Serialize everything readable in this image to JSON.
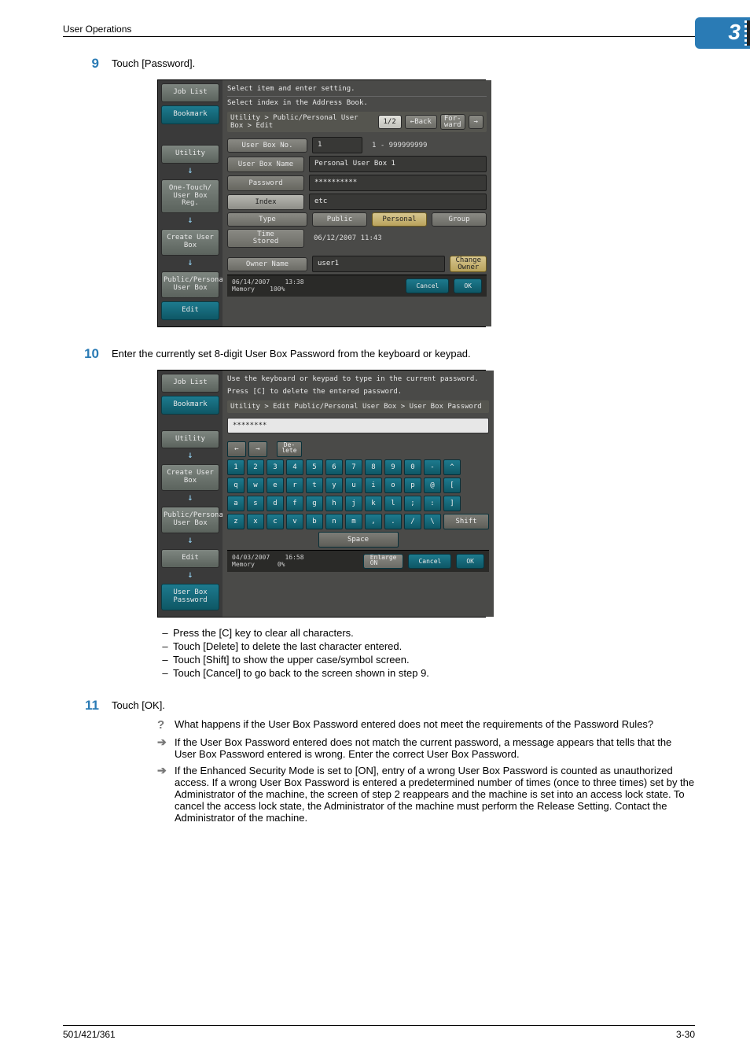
{
  "header": {
    "section": "User Operations",
    "chapter": "3"
  },
  "steps": {
    "s9": {
      "num": "9",
      "text": "Touch [Password]."
    },
    "s10": {
      "num": "10",
      "text": "Enter the currently set 8-digit User Box Password from the keyboard or keypad."
    },
    "s11": {
      "num": "11",
      "text": "Touch [OK]."
    }
  },
  "shot1": {
    "side": {
      "job_list": "Job List",
      "bookmark": "Bookmark",
      "utility": "Utility",
      "one_touch": "One-Touch/\nUser Box Reg.",
      "create_box": "Create User Box",
      "pub_personal": "Public/Personal\nUser Box",
      "edit": "Edit"
    },
    "top1": "Select item and enter setting.",
    "top2": "Select index in the Address Book.",
    "crumb": "Utility > Public/Personal User  Box > Edit",
    "page_ind": "1/2",
    "back": "Back",
    "forward": "For-\nward",
    "nav_prev": "←",
    "nav_next": "→",
    "labels": {
      "boxno": "User Box No.",
      "boxname": "User Box Name",
      "password": "Password",
      "index": "Index",
      "type": "Type",
      "timestored": "Time\nStored",
      "owner": "Owner Name"
    },
    "values": {
      "boxno": "1",
      "boxno_range": "1  -  999999999",
      "boxname": "Personal User Box 1",
      "password": "**********",
      "index": "etc",
      "type_public": "Public",
      "type_personal": "Personal",
      "type_group": "Group",
      "timestored": "06/12/2007   11:43",
      "owner": "user1",
      "change_owner": "Change\nOwner"
    },
    "status": {
      "date": "06/14/2007",
      "time": "13:38",
      "mem_lbl": "Memory",
      "mem": "100%",
      "cancel": "Cancel",
      "ok": "OK"
    }
  },
  "shot2": {
    "side": {
      "job_list": "Job List",
      "bookmark": "Bookmark",
      "utility": "Utility",
      "create_box": "Create User Box",
      "pub_personal": "Public/Personal\nUser Box",
      "edit": "Edit",
      "ub_password": "User Box\nPassword"
    },
    "top1": "Use the keyboard or keypad to type in the current password.",
    "top2": "Press [C] to delete the entered password.",
    "crumb": "Utility > Edit Public/Personal User Box > User Box Password",
    "input": "********",
    "toolbar": {
      "left": "←",
      "right": "→",
      "delete": "De-\nlete"
    },
    "row_num": [
      "1",
      "2",
      "3",
      "4",
      "5",
      "6",
      "7",
      "8",
      "9",
      "0",
      "-",
      "^"
    ],
    "row_q": [
      "q",
      "w",
      "e",
      "r",
      "t",
      "y",
      "u",
      "i",
      "o",
      "p",
      "@",
      "["
    ],
    "row_a": [
      "a",
      "s",
      "d",
      "f",
      "g",
      "h",
      "j",
      "k",
      "l",
      ";",
      ":",
      "]"
    ],
    "row_z": [
      "z",
      "x",
      "c",
      "v",
      "b",
      "n",
      "m",
      ",",
      ".",
      "/",
      "\\"
    ],
    "shift": "Shift",
    "space": "Space",
    "status": {
      "date": "04/03/2007",
      "time": "16:58",
      "mem_lbl": "Memory",
      "mem": "0%",
      "enlarge": "Enlarge\nON",
      "cancel": "Cancel",
      "ok": "OK"
    }
  },
  "bullets": {
    "b1": "Press the [C] key to clear all characters.",
    "b2": "Touch [Delete] to delete the last character entered.",
    "b3": "Touch [Shift] to show the upper case/symbol screen.",
    "b4": "Touch [Cancel] to go back to the screen shown in step 9."
  },
  "qa": {
    "q": "What happens if the User Box Password entered does not meet the requirements of the Password Rules?",
    "a1": "If the User Box Password entered does not match the current password, a message appears that tells that the User Box Password entered is wrong. Enter the correct User Box Password.",
    "a2": "If the Enhanced Security Mode is set to [ON], entry of a wrong User Box Password is counted as unauthorized access. If a wrong User Box Password is entered a predetermined number of times (once to three times) set by the Administrator of the machine, the screen of step 2 reappears and the machine is set into an access lock state. To cancel the access lock state, the Administrator of the machine must perform the Release Setting. Contact the Administrator of the machine."
  },
  "footer": {
    "left": "501/421/361",
    "right": "3-30"
  }
}
